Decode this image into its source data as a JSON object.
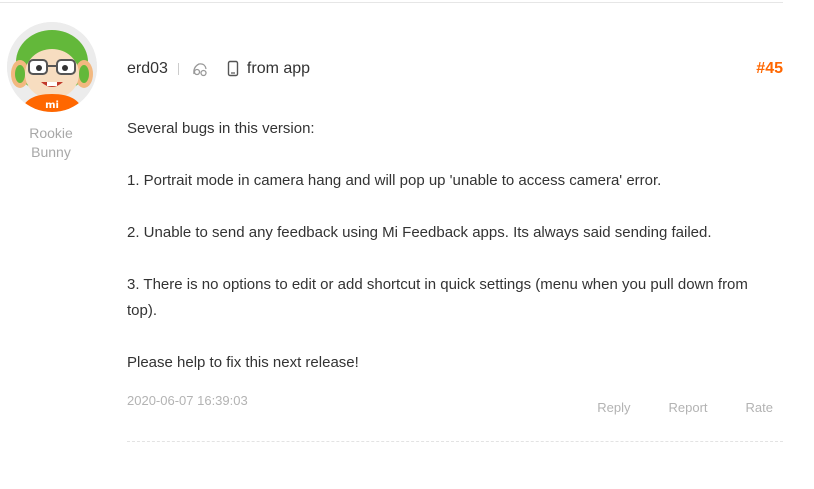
{
  "post": {
    "author": {
      "username": "erd03",
      "rank_line1": "Rookie",
      "rank_line2": "Bunny",
      "avatar_icon": "mi-bunny-avatar",
      "badge_icon": "rookie-hat-icon"
    },
    "source_icon": "phone-icon",
    "source_label": "from app",
    "floor": "#45",
    "floor_color": "#ff6700",
    "body": [
      "Several bugs in this version:",
      "1. Portrait mode in camera hang and will pop up 'unable to access camera' error.",
      "2. Unable to send any feedback using Mi Feedback apps. Its always said sending failed.",
      "3. There is no options to edit or add shortcut in quick settings (menu when you pull down from top).",
      "Please help to fix this next release!"
    ],
    "date": "2020-06-07 16:39:03",
    "actions": {
      "reply": "Reply",
      "report": "Report",
      "rate": "Rate"
    }
  }
}
